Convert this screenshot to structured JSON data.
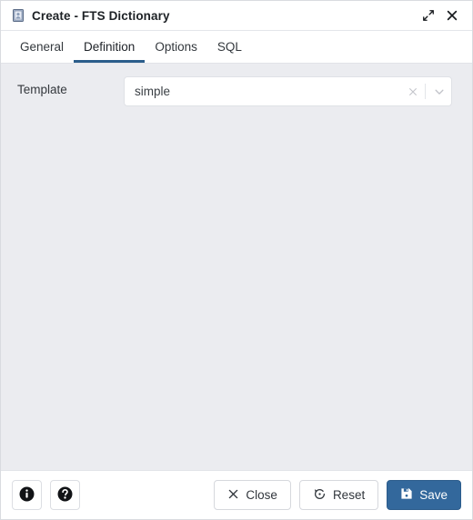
{
  "window": {
    "title": "Create - FTS Dictionary",
    "icon": "fts-dictionary-icon",
    "controls": {
      "expand": "expand-icon",
      "close": "close-icon"
    }
  },
  "tabs": [
    {
      "label": "General",
      "active": false
    },
    {
      "label": "Definition",
      "active": true
    },
    {
      "label": "Options",
      "active": false
    },
    {
      "label": "SQL",
      "active": false
    }
  ],
  "form": {
    "template": {
      "label": "Template",
      "value": "simple",
      "placeholder": "Select an item...",
      "clear_icon": "clear-x-icon",
      "dropdown_icon": "chevron-down-icon"
    }
  },
  "footer": {
    "info_icon": "info-icon",
    "help_icon": "help-icon",
    "close_label": "Close",
    "reset_label": "Reset",
    "save_label": "Save"
  },
  "colors": {
    "accent": "#2b5d8b",
    "primary_button": "#33689c",
    "body_background": "#ebecf0",
    "panel": "#ffffff"
  }
}
